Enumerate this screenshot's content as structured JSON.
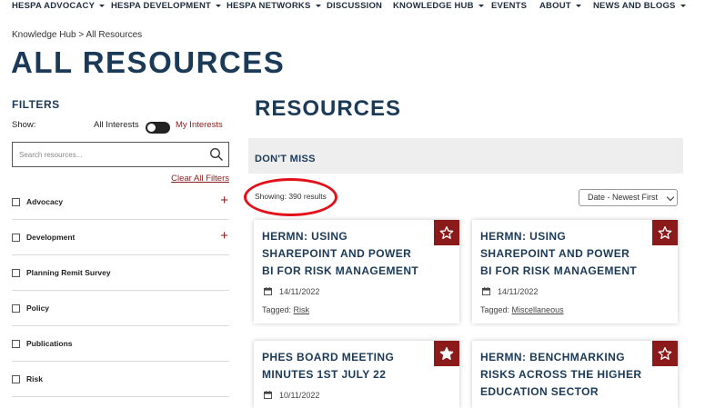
{
  "nav": {
    "items": [
      {
        "label": "HESPA ADVOCACY",
        "caret": true
      },
      {
        "label": "HESPA DEVELOPMENT",
        "caret": true
      },
      {
        "label": "HESPA NETWORKS",
        "caret": true
      },
      {
        "label": "DISCUSSION",
        "caret": false
      },
      {
        "label": "KNOWLEDGE HUB",
        "caret": true
      },
      {
        "label": "EVENTS",
        "caret": false
      },
      {
        "label": "ABOUT",
        "caret": true
      },
      {
        "label": "NEWS AND BLOGS",
        "caret": true
      }
    ]
  },
  "breadcrumb": "Knowledge Hub > All Resources",
  "page_title": "ALL RESOURCES",
  "filters": {
    "title": "FILTERS",
    "show_label": "Show:",
    "toggle_left": "All Interests",
    "toggle_right": "My Interests",
    "search_placeholder": "Search resources...",
    "clear_all": "Clear All Filters",
    "items": [
      {
        "label": "Advocacy",
        "expandable": true
      },
      {
        "label": "Development",
        "expandable": true
      },
      {
        "label": "Planning Remit Survey",
        "expandable": false
      },
      {
        "label": "Policy",
        "expandable": false
      },
      {
        "label": "Publications",
        "expandable": false
      },
      {
        "label": "Risk",
        "expandable": false
      }
    ]
  },
  "main": {
    "title": "RESOURCES",
    "dont_miss": "DON'T MISS",
    "showing": "Showing: 390 results",
    "sort_selected": "Date - Newest First",
    "tagged_label": "Tagged:",
    "cards": [
      {
        "title": "HERMN: USING SHAREPOINT AND POWER BI FOR RISK MANAGEMENT",
        "date": "14/11/2022",
        "tag": "Risk",
        "starred": false
      },
      {
        "title": "HERMN: USING SHAREPOINT AND POWER BI FOR RISK MANAGEMENT",
        "date": "14/11/2022",
        "tag": "Miscellaneous",
        "starred": false
      },
      {
        "title": "PHES BOARD MEETING MINUTES 1ST JULY 22",
        "date": "10/11/2022",
        "tag": "",
        "starred": true
      },
      {
        "title": "HERMN: BENCHMARKING RISKS ACROSS THE HIGHER EDUCATION SECTOR",
        "date": "",
        "tag": "",
        "starred": false
      }
    ]
  },
  "colors": {
    "brand_navy": "#1b3a57",
    "accent_red": "#8b1a1a",
    "highlight": "#e3101a"
  }
}
